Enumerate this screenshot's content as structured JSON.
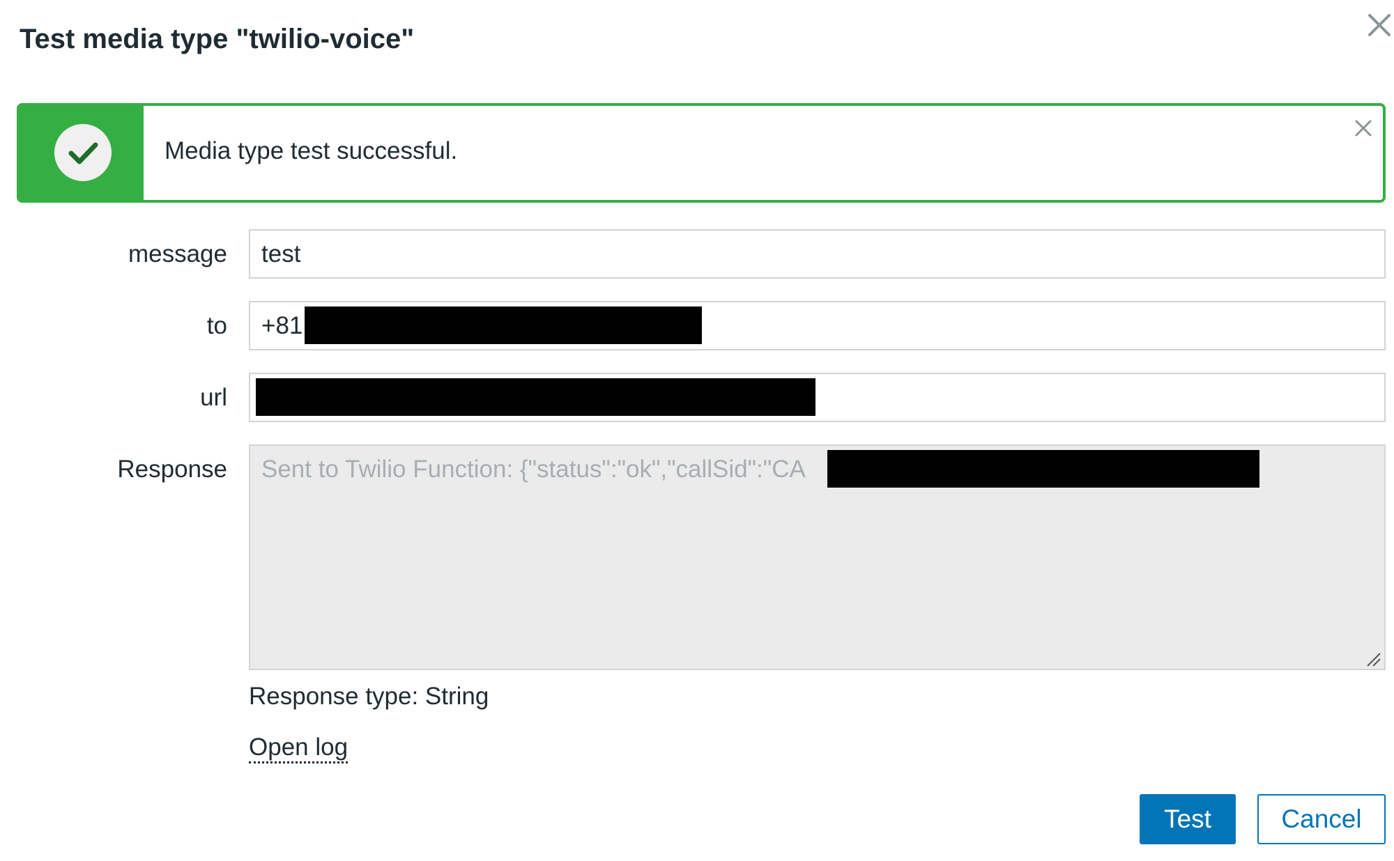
{
  "dialog": {
    "title": "Test media type \"twilio-voice\""
  },
  "message_box": {
    "text": "Media type test successful.",
    "accent_color": "#34af43"
  },
  "form": {
    "message": {
      "label": "message",
      "value": "test"
    },
    "to": {
      "label": "to",
      "value": "+81"
    },
    "url": {
      "label": "url",
      "value": ""
    },
    "response": {
      "label": "Response",
      "value_prefix": "Sent to Twilio Function: {\"status\":\"ok\",\"callSid\":\"CA",
      "value_suffix": "\"}"
    },
    "response_type": "Response type: String",
    "open_log": "Open log"
  },
  "buttons": {
    "test": "Test",
    "cancel": "Cancel",
    "primary_color": "#0275b8"
  },
  "icons": {
    "close": "close-icon",
    "success": "check-circle-icon",
    "message_close": "close-icon",
    "resize": "resize-grip-icon"
  }
}
